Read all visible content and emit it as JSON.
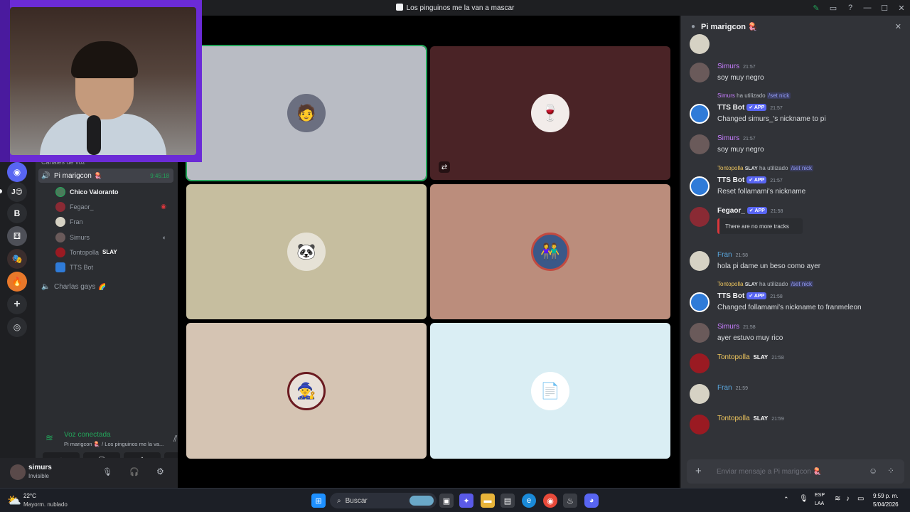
{
  "window": {
    "title": "Los pinguinos me la van a mascar"
  },
  "channels": {
    "category": "Canales de voz",
    "active_channel": "Pi marigcon",
    "active_emoji": "🪼",
    "timer": "9:45:18",
    "users": [
      {
        "name": "Chico Valoranto",
        "tag": ""
      },
      {
        "name": "Fegaor_",
        "tag": ""
      },
      {
        "name": "Fran",
        "tag": ""
      },
      {
        "name": "Simurs",
        "tag": ""
      },
      {
        "name": "Tontopolla",
        "tag": "SLAY"
      },
      {
        "name": "TTS Bot",
        "tag": ""
      }
    ],
    "other_channel": "Charlas gays",
    "other_emoji": "🌈"
  },
  "voice_panel": {
    "status": "Voz conectada",
    "subtitle": "Pi marigcon 🪼 / Los pinguinos me la va..."
  },
  "user_panel": {
    "username": "simurs",
    "status": "Invisible"
  },
  "chat": {
    "header": "Pi marigcon 🪼",
    "messages": [
      {
        "author": "",
        "time": "",
        "text": ""
      },
      {
        "author": "Simurs",
        "time": "21:57",
        "text": "soy muy negro"
      },
      {
        "reply_user": "Simurs",
        "reply_action": "ha utilizado",
        "reply_cmd": "/set nick",
        "author": "TTS Bot",
        "badge": "✔ APP",
        "time": "21:57",
        "text": "Changed simurs_'s nickname to pi"
      },
      {
        "author": "Simurs",
        "time": "21:57",
        "text": "soy muy negro"
      },
      {
        "reply_user": "Tontopolla",
        "reply_tag": "SLAY",
        "reply_action": "ha utilizado",
        "reply_cmd": "/set nick",
        "author": "TTS Bot",
        "badge": "✔ APP",
        "time": "21:57",
        "text": "Reset follamami's nickname"
      },
      {
        "author": "Fegaor_",
        "badge": "✔ APP",
        "time": "21:58",
        "embed": "There are no more tracks"
      },
      {
        "author": "Fran",
        "time": "21:58",
        "text": "hola pi dame un beso como ayer"
      },
      {
        "reply_user": "Tontopolla",
        "reply_tag": "SLAY",
        "reply_action": "ha utilizado",
        "reply_cmd": "/set nick",
        "author": "TTS Bot",
        "badge": "✔ APP",
        "time": "21:58",
        "text": "Changed follamami's nickname to franmeleon"
      },
      {
        "author": "Simurs",
        "time": "21:58",
        "text": "ayer estuvo muy rico"
      },
      {
        "author": "Tontopolla",
        "tag": "SLAY",
        "time": "21:58",
        "text": ""
      },
      {
        "author": "Fran",
        "time": "21:59",
        "text": ""
      },
      {
        "author": "Tontopolla",
        "tag": "SLAY",
        "time": "21:59",
        "text": ""
      }
    ],
    "input_placeholder": "Enviar mensaje a Pi marigcon 🪼"
  },
  "taskbar": {
    "weather_temp": "22°C",
    "weather_desc": "Mayorm. nublado",
    "search_label": "Buscar",
    "lang_top": "ESP",
    "lang_bottom": "LAA",
    "clock_time": "9:59 p. m.",
    "clock_date": "5/04/2026"
  },
  "colors": {
    "accent_green": "#23a55a",
    "discord_blurple": "#5865f2",
    "simurs": "#c77dff",
    "fran": "#5aa8e0",
    "tontopolla": "#f0c75e"
  }
}
